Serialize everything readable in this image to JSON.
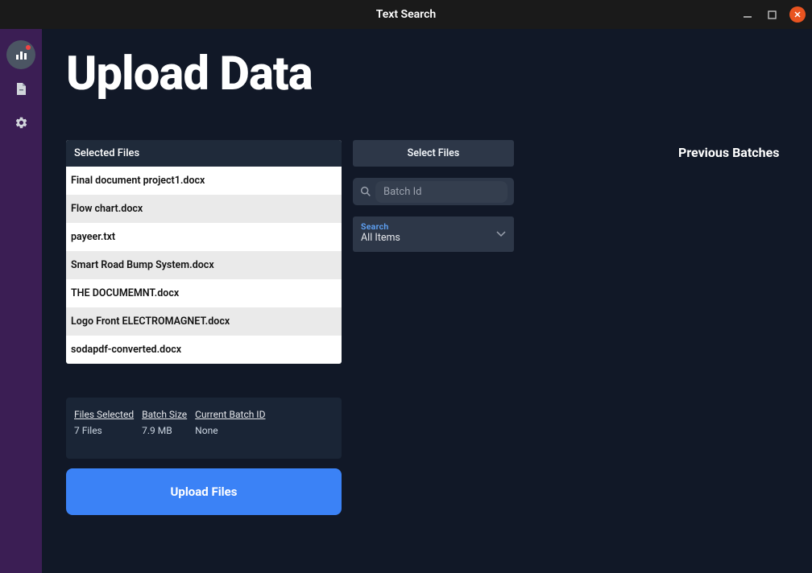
{
  "window": {
    "title": "Text Search"
  },
  "page": {
    "title": "Upload Data"
  },
  "files": {
    "header": "Selected Files",
    "list": [
      "Final document project1.docx",
      "Flow chart.docx",
      "payeer.txt",
      "Smart Road Bump System.docx",
      "THE DOCUMEMNT.docx",
      "Logo Front ELECTROMAGNET.docx",
      "sodapdf-converted.docx"
    ]
  },
  "stats": {
    "files_selected_label": "Files Selected",
    "files_selected_value": "7 Files",
    "batch_size_label": "Batch Size",
    "batch_size_value": "7.9 MB",
    "current_batch_id_label": "Current Batch ID",
    "current_batch_id_value": "None"
  },
  "buttons": {
    "upload_files": "Upload Files",
    "select_files": "Select Files"
  },
  "batch_input": {
    "placeholder": "Batch Id"
  },
  "search_select": {
    "label": "Search",
    "value": "All Items"
  },
  "previous_batches": {
    "header": "Previous Batches"
  }
}
